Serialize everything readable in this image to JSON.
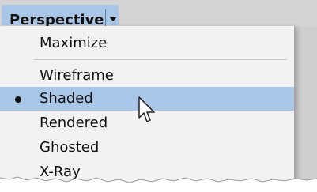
{
  "perspective_button": {
    "label": "Perspective"
  },
  "menu": {
    "items": [
      {
        "label": "Maximize",
        "checked": false
      },
      {
        "label": "Wireframe",
        "checked": false
      },
      {
        "label": "Shaded",
        "checked": true
      },
      {
        "label": "Rendered",
        "checked": false
      },
      {
        "label": "Ghosted",
        "checked": false
      },
      {
        "label": "X-Ray",
        "checked": false
      }
    ]
  },
  "colors": {
    "selection": "#a9c6e6",
    "menu_bg": "#f2f2f2",
    "header_bg": "#d4d4d4"
  },
  "icons": {
    "dropdown": "chevron-down-icon",
    "cursor": "mouse-cursor-icon",
    "bullet": "radio-bullet-icon"
  }
}
